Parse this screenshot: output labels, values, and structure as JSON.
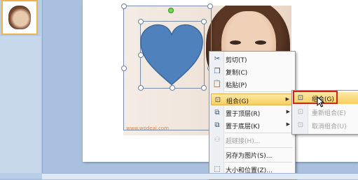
{
  "context_menu": {
    "items": [
      {
        "icon": "scissors-icon",
        "glyph": "✂",
        "label": "剪切(T)",
        "enabled": true
      },
      {
        "icon": "copy-icon",
        "glyph": "❐",
        "label": "复制(C)",
        "enabled": true
      },
      {
        "icon": "paste-icon",
        "glyph": "📋",
        "label": "粘贴(P)",
        "enabled": true
      },
      {
        "icon": "group-icon",
        "glyph": "⊡",
        "label": "组合(G)",
        "enabled": true,
        "submenu": true,
        "active": true
      },
      {
        "icon": "bring-to-front-icon",
        "glyph": "⧉",
        "label": "置于顶层(R)",
        "enabled": true,
        "submenu": true
      },
      {
        "icon": "send-to-back-icon",
        "glyph": "⧉",
        "label": "置于底层(K)",
        "enabled": true,
        "submenu": true
      },
      {
        "icon": "hyperlink-icon",
        "glyph": "⚇",
        "label": "超链接(H)...",
        "enabled": false
      },
      {
        "icon": "",
        "glyph": "",
        "label": "另存为图片(S)...",
        "enabled": true
      },
      {
        "icon": "size-position-icon",
        "glyph": "⬚",
        "label": "大小和位置(Z)...",
        "enabled": true
      }
    ]
  },
  "group_submenu": {
    "items": [
      {
        "icon": "group-icon",
        "glyph": "⊡",
        "label": "组合(G)",
        "enabled": true,
        "active": true
      },
      {
        "icon": "regroup-icon",
        "glyph": "⊡",
        "label": "重新组合(E)",
        "enabled": false
      },
      {
        "icon": "ungroup-icon",
        "glyph": "⊡",
        "label": "取消组合(U)",
        "enabled": false
      }
    ]
  },
  "slide": {
    "watermark": "www.wodeai.com"
  },
  "colors": {
    "heart_fill": "#4f81bd",
    "heart_stroke": "#3a6596",
    "highlight": "#f7cf5e",
    "callout": "#d62020"
  }
}
